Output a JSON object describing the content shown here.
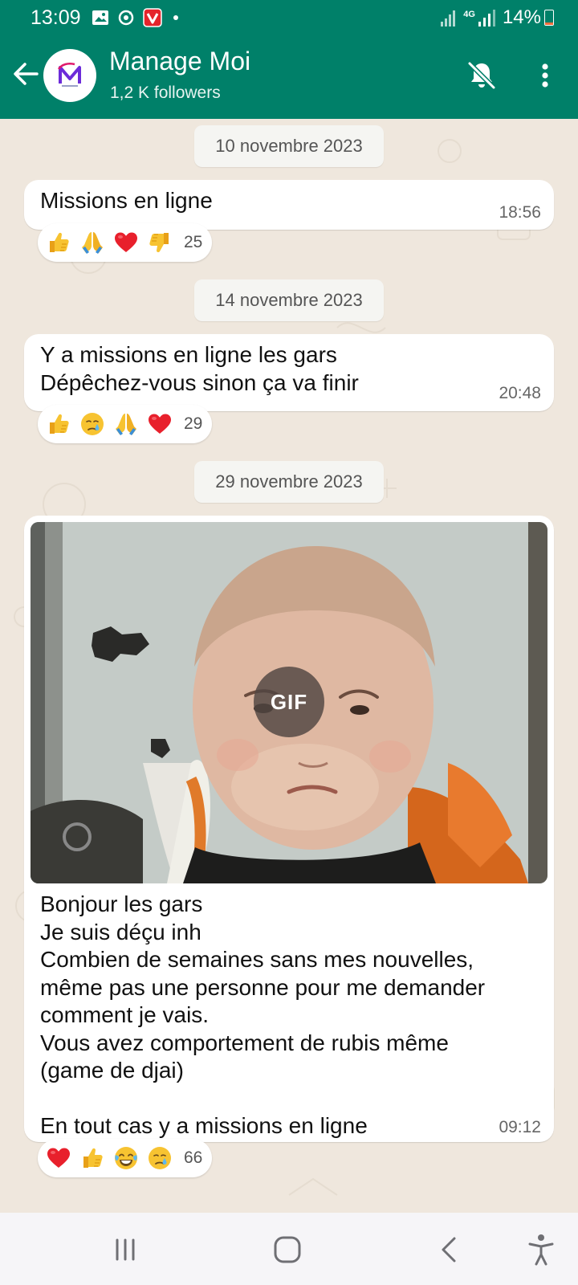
{
  "status_bar": {
    "time": "13:09",
    "network": "4G",
    "battery": "14%",
    "battery_level": 0.14,
    "icons": [
      "gallery-icon",
      "sync-icon",
      "app-v-icon",
      "notification-dot-icon",
      "signal-icon",
      "signal-4g-icon"
    ]
  },
  "header": {
    "title": "Manage Moi",
    "subtitle": "1,2 K followers",
    "icons": [
      "back-arrow-icon",
      "channel-avatar",
      "bell-off-icon",
      "more-vert-icon"
    ]
  },
  "messages": [
    {
      "date": "10 novembre 2023",
      "text": "Missions en ligne",
      "time": "18:56",
      "reactions": [
        "thumbs-up",
        "folded-hands",
        "red-heart",
        "thumbs-down"
      ],
      "reaction_count": "25"
    },
    {
      "date": "14 novembre 2023",
      "text": "Y a missions en ligne les gars\nDépêchez-vous sinon ça va finir",
      "time": "20:48",
      "reactions": [
        "thumbs-up",
        "crying-face",
        "folded-hands",
        "red-heart"
      ],
      "reaction_count": "29"
    },
    {
      "date": "29 novembre 2023",
      "gif_label": "GIF",
      "text": "Bonjour les gars\nJe suis déçu inh\nCombien de semaines sans mes nouvelles,\nmême pas une personne pour me demander\ncomment je vais.\nVous avez comportement de rubis même\n(game de djai)\n\nEn tout cas y a missions en ligne",
      "time": "09:12",
      "reactions": [
        "red-heart",
        "thumbs-up",
        "tears-of-joy",
        "crying-face"
      ],
      "reaction_count": "66"
    }
  ],
  "nav_bar": {
    "icons": [
      "recent-apps-icon",
      "home-icon",
      "back-icon",
      "accessibility-icon"
    ]
  },
  "colors": {
    "header_bg": "#008069",
    "chat_bg": "#efe7dd",
    "bubble_bg": "#ffffff",
    "date_pill_bg": "#f5f5f2",
    "battery_low": "#ef6c3a"
  }
}
